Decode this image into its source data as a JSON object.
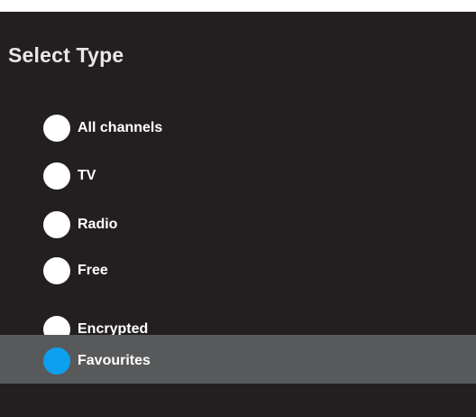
{
  "header": {
    "title": "Select Type"
  },
  "options": [
    {
      "label": "All channels",
      "selected": false
    },
    {
      "label": "TV",
      "selected": false
    },
    {
      "label": "Radio",
      "selected": false
    },
    {
      "label": "Free",
      "selected": false
    },
    {
      "label": "Encrypted",
      "selected": false
    },
    {
      "label": "Favourites",
      "selected": true
    }
  ],
  "colors": {
    "background": "#231f20",
    "selected_row": "#58595b",
    "selected_radio": "#0da0ee",
    "unselected_radio": "#ffffff",
    "text": "#ffffff"
  }
}
